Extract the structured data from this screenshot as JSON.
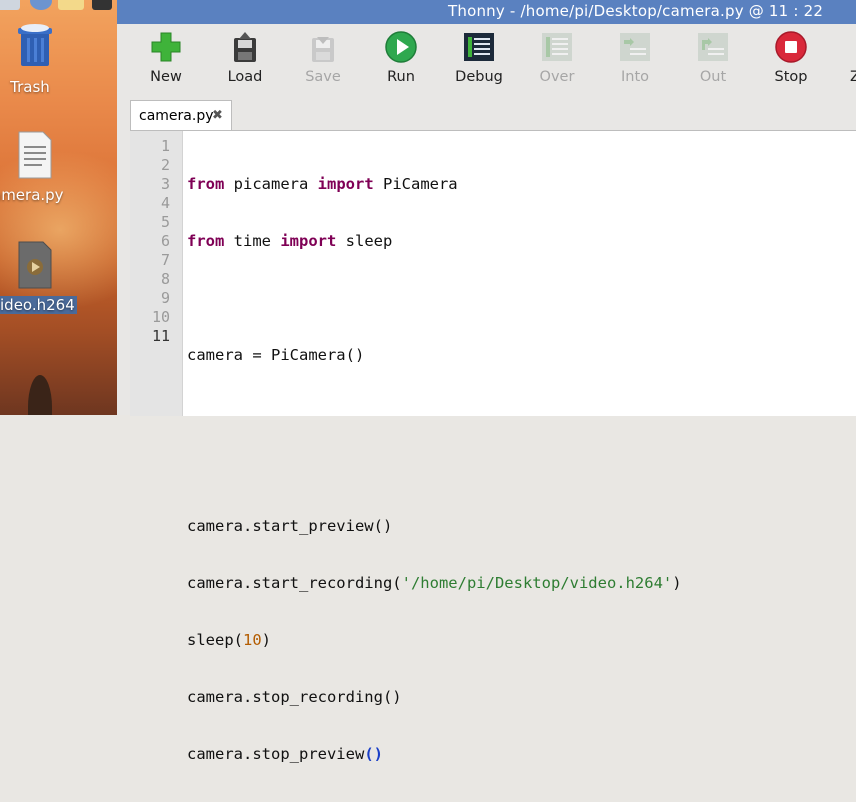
{
  "window": {
    "title": "Thonny  -  /home/pi/Desktop/camera.py  @  11 : 22"
  },
  "desktop": {
    "icons": [
      {
        "label": "Trash",
        "icon": "trash-icon"
      },
      {
        "label": "amera.py",
        "icon": "python-file-icon"
      },
      {
        "label": "ideo.h264",
        "icon": "video-file-icon"
      }
    ]
  },
  "toolbar": {
    "buttons": [
      {
        "label": "New",
        "icon": "new-file-icon",
        "enabled": true
      },
      {
        "label": "Load",
        "icon": "load-icon",
        "enabled": true
      },
      {
        "label": "Save",
        "icon": "save-icon",
        "enabled": false
      },
      {
        "label": "Run",
        "icon": "run-icon",
        "enabled": true
      },
      {
        "label": "Debug",
        "icon": "debug-icon",
        "enabled": true
      },
      {
        "label": "Over",
        "icon": "step-over-icon",
        "enabled": false
      },
      {
        "label": "Into",
        "icon": "step-into-icon",
        "enabled": false
      },
      {
        "label": "Out",
        "icon": "step-out-icon",
        "enabled": false
      },
      {
        "label": "Stop",
        "icon": "stop-icon",
        "enabled": true
      },
      {
        "label": "Z",
        "icon": "zoom-icon",
        "enabled": true
      }
    ]
  },
  "editor": {
    "tab": {
      "name": "camera.py",
      "close": "✖"
    },
    "line_numbers": [
      "1",
      "2",
      "3",
      "4",
      "5",
      "6",
      "7",
      "8",
      "9",
      "10",
      "11"
    ],
    "current_line": "11",
    "code": {
      "l1": {
        "kw1": "from",
        "t1": " picamera ",
        "kw2": "import",
        "t2": " PiCamera"
      },
      "l2": {
        "kw1": "from",
        "t1": " time ",
        "kw2": "import",
        "t2": " sleep"
      },
      "l4": "camera = PiCamera()",
      "l7": "camera.start_preview()",
      "l8": {
        "t1": "camera.start_recording(",
        "s": "'/home/pi/Desktop/video.h264'",
        "t2": ")"
      },
      "l9": {
        "t1": "sleep(",
        "n": "10",
        "t2": ")"
      },
      "l10": "camera.stop_recording()",
      "l11": {
        "t1": "camera.stop_preview",
        "p": "()"
      }
    }
  },
  "colors": {
    "titlebar": "#5a81c0",
    "keyword": "#7f0055",
    "string": "#2e7d32",
    "number": "#b35c00",
    "run_green": "#2fa84f",
    "stop_red": "#d9283a"
  }
}
